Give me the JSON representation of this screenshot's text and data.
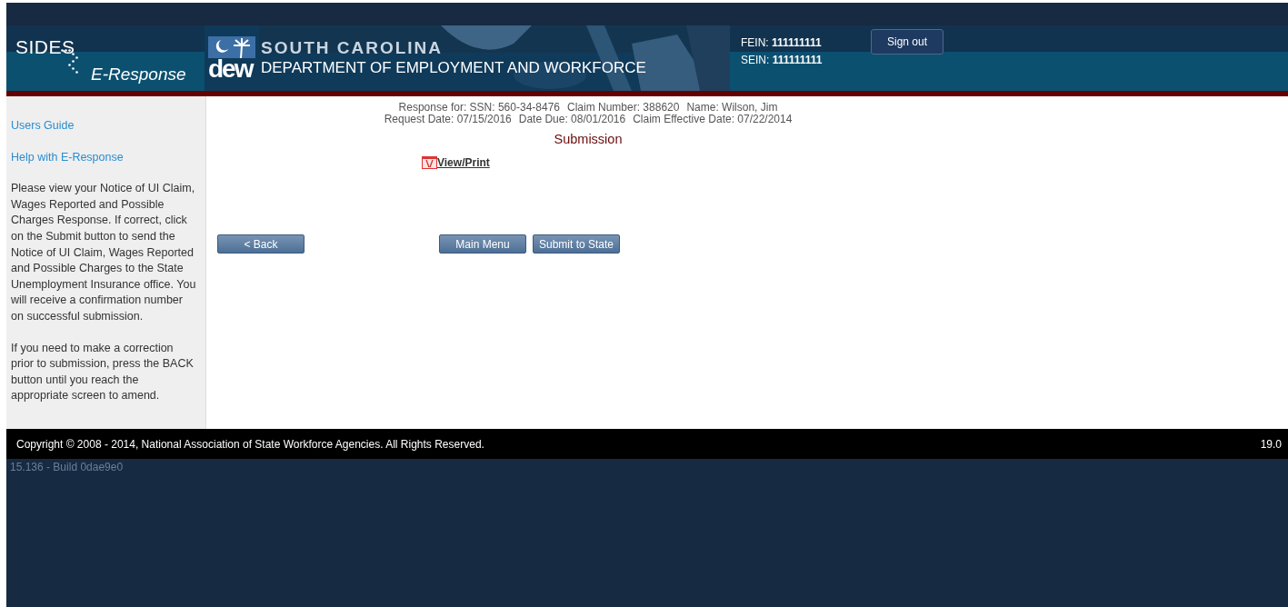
{
  "header": {
    "logo_top": "SIDES",
    "logo_bottom": "E-Response",
    "agency_state": "SOUTH CAROLINA",
    "agency_mark": "dew",
    "agency_name": "DEPARTMENT OF EMPLOYMENT AND WORKFORCE",
    "ids": [
      {
        "label": "FEIN:",
        "value": "111111111"
      },
      {
        "label": "SEIN:",
        "value": "111111111"
      }
    ],
    "sign_out": "Sign out"
  },
  "sidebar": {
    "links": [
      "Users Guide",
      "Help with E-Response"
    ],
    "paragraphs": [
      "Please view your Notice of UI Claim, Wages Reported and Possible Charges Response. If correct, click on the Submit button to send the Notice of UI Claim, Wages Reported and Possible Charges to the State Unemployment Insurance office. You will receive a confirmation number on successful submission.",
      "If you need to make a correction prior to submission, press the BACK button until you reach the appropriate screen to amend."
    ]
  },
  "main": {
    "info_lines": [
      [
        "Response for: SSN: 560-34-8476",
        "Claim Number: 388620",
        "Name: Wilson, Jim"
      ],
      [
        "Request Date: 07/15/2016",
        "Date Due: 08/01/2016",
        "Claim Effective Date: 07/22/2014"
      ]
    ],
    "title": "Submission",
    "view_print": "View/Print",
    "buttons": [
      {
        "label": "< Back",
        "kind": "back"
      },
      {
        "label": "Main Menu",
        "kind": "main"
      },
      {
        "label": "Submit to State",
        "kind": "main"
      }
    ]
  },
  "footer": {
    "copyright": "Copyright © 2008 - 2014, National Association of State Workforce Agencies. All Rights Reserved.",
    "version": "19.0",
    "build": "15.136 - Build 0dae9e0"
  }
}
